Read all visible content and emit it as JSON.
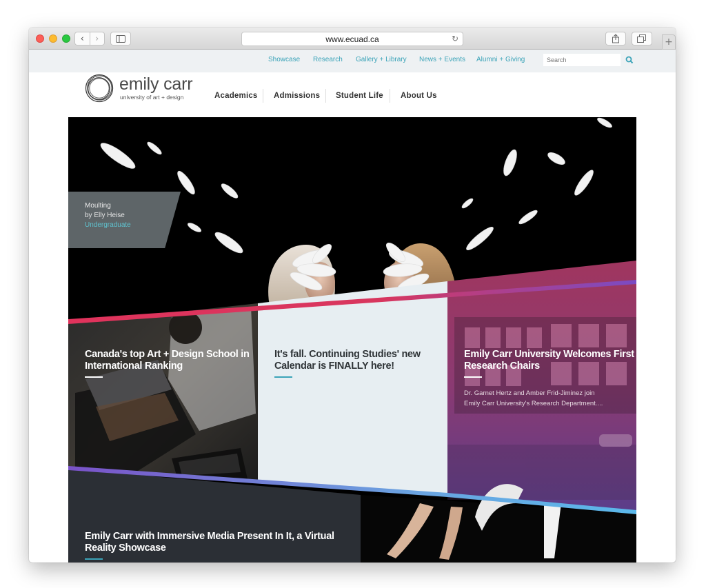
{
  "browser": {
    "url": "www.ecuad.ca"
  },
  "utility_nav": {
    "links": [
      {
        "label": "Showcase"
      },
      {
        "label": "Research"
      },
      {
        "label": "Gallery + Library"
      },
      {
        "label": "News + Events"
      },
      {
        "label": "Alumni + Giving"
      }
    ],
    "search_placeholder": "Search"
  },
  "brand": {
    "name": "emily carr",
    "tagline": "university of art + design"
  },
  "main_nav": {
    "items": [
      {
        "label": "Academics"
      },
      {
        "label": "Admissions"
      },
      {
        "label": "Student Life"
      },
      {
        "label": "About Us"
      }
    ]
  },
  "hero": {
    "caption": {
      "title": "Moulting",
      "byline": "by Elly Heise",
      "category": "Undergraduate"
    }
  },
  "cards": [
    {
      "title_line1": "Canada's top Art + Design School in",
      "title_line2": "International Ranking"
    },
    {
      "title_line1": "It's fall. Continuing Studies' new",
      "title_line2": "Calendar is FINALLY here!"
    },
    {
      "title_line1": "Emily Carr University Welcomes First",
      "title_line2": "Research Chairs",
      "desc_line1": "Dr. Garnet Hertz and Amber Frid-Jiminez join",
      "desc_line2": "Emily Carr University's Research Department...."
    },
    {
      "title_line1": "Emily Carr with Immersive Media Present In It, a Virtual",
      "title_line2": "Reality Showcase"
    }
  ],
  "colors": {
    "accent_teal": "#3aa3b8",
    "accent_pink": "#e0335c",
    "accent_purple": "#7a4bc4",
    "dark_panel": "#2b2f35"
  }
}
